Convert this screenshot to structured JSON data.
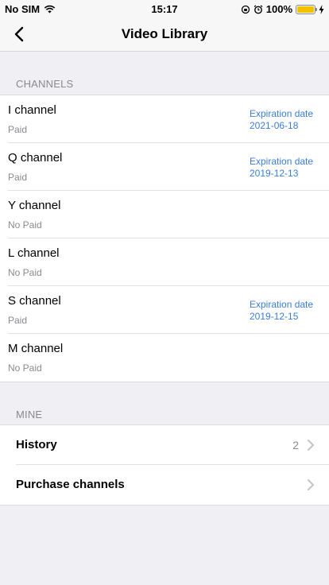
{
  "status_bar": {
    "carrier": "No SIM",
    "time": "15:17",
    "battery_text": "100%",
    "battery_color": "#f2c200"
  },
  "nav": {
    "title": "Video Library",
    "back_icon": "chevron-left-icon"
  },
  "channels_section": {
    "header": "CHANNELS",
    "items": [
      {
        "name": "I channel",
        "status": "Paid",
        "exp_label": "Expiration date",
        "exp_date": "2021-06-18"
      },
      {
        "name": "Q channel",
        "status": "Paid",
        "exp_label": "Expiration date",
        "exp_date": "2019-12-13"
      },
      {
        "name": "Y channel",
        "status": "No Paid",
        "exp_label": "",
        "exp_date": ""
      },
      {
        "name": "L channel",
        "status": "No Paid",
        "exp_label": "",
        "exp_date": ""
      },
      {
        "name": "S channel",
        "status": "Paid",
        "exp_label": "Expiration date",
        "exp_date": "2019-12-15"
      },
      {
        "name": "M channel",
        "status": "No Paid",
        "exp_label": "",
        "exp_date": ""
      }
    ]
  },
  "mine_section": {
    "header": "MINE",
    "history_label": "History",
    "history_count": "2",
    "purchase_label": "Purchase channels"
  },
  "colors": {
    "accent": "#3b7dd8",
    "secondary_text": "#8a8a8f",
    "background": "#efeff4"
  }
}
